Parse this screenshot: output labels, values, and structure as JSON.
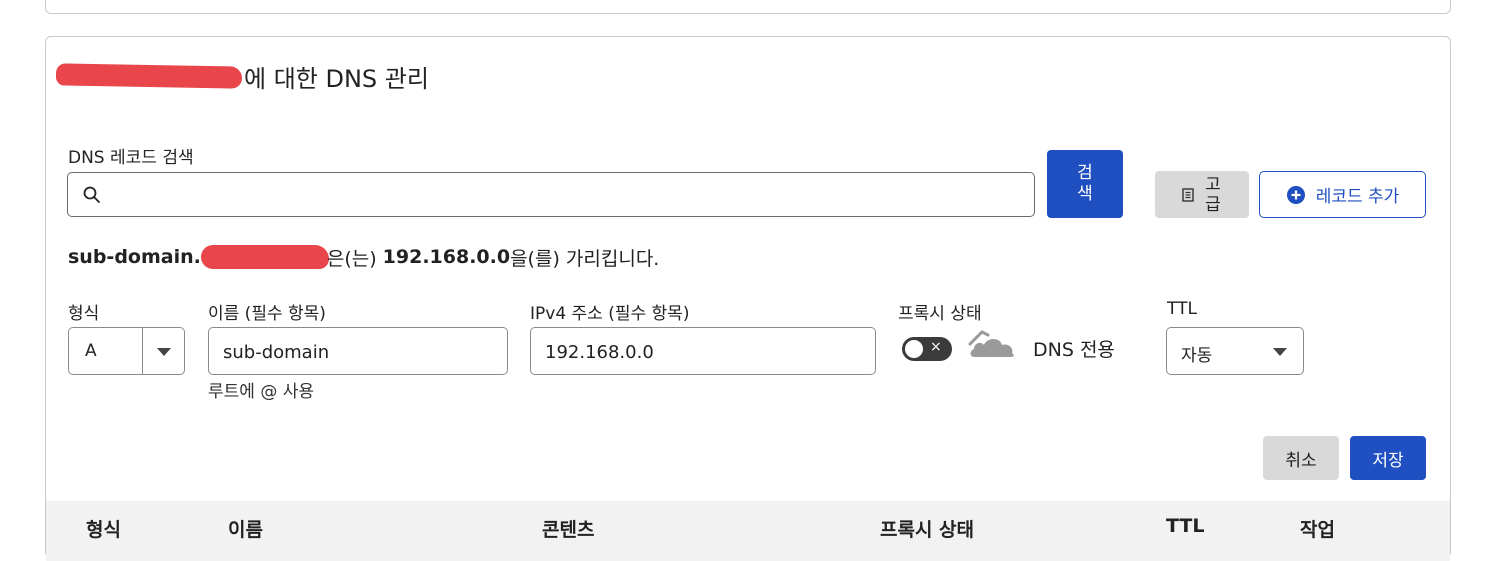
{
  "header": {
    "title_suffix": "에 대한 DNS 관리"
  },
  "search": {
    "label": "DNS 레코드 검색",
    "value": "",
    "placeholder": "",
    "search_button": "검색",
    "advanced_button": "고급",
    "add_record_button": "레코드 추가"
  },
  "points_to": {
    "name_prefix": "sub-domain.",
    "middle": "은(는)",
    "ip": "192.168.0.0",
    "suffix": "을(를) 가리킵니다."
  },
  "form": {
    "type_label": "형식",
    "type_value": "A",
    "name_label": "이름 (필수 항목)",
    "name_value": "sub-domain",
    "name_hint": "루트에 @ 사용",
    "ipv4_label": "IPv4 주소 (필수 항목)",
    "ipv4_value": "192.168.0.0",
    "proxy_label": "프록시 상태",
    "proxy_enabled": false,
    "proxy_toggle_symbol": "×",
    "proxy_status_text": "DNS 전용",
    "ttl_label": "TTL",
    "ttl_value": "자동",
    "cancel_button": "취소",
    "save_button": "저장"
  },
  "table": {
    "columns": [
      "형식",
      "이름",
      "콘텐츠",
      "프록시 상태",
      "TTL",
      "작업"
    ]
  },
  "colors": {
    "primary": "#1f4fc1",
    "secondary_button": "#d9d9d9",
    "redaction": "#e8464b",
    "toggle_off": "#3b3b3b",
    "cloud_gray": "#9a9a9a"
  }
}
